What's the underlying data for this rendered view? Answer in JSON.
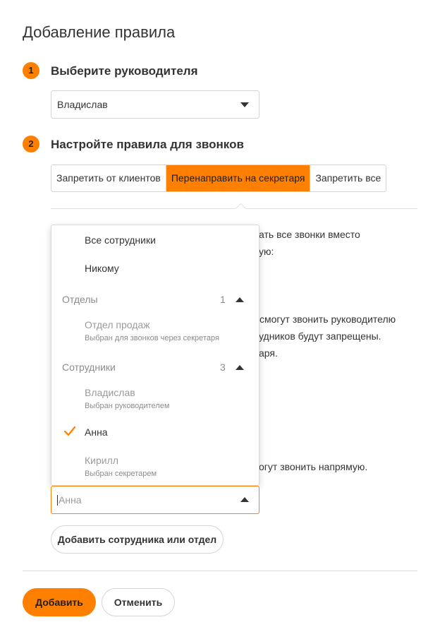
{
  "page": {
    "title": "Добавление правила"
  },
  "steps": [
    {
      "number": "1",
      "title": "Выберите руководителя"
    },
    {
      "number": "2",
      "title": "Настройте правила для звонков"
    }
  ],
  "manager_select": {
    "value": "Владислав"
  },
  "rule_tabs": [
    {
      "label": "Запретить от клиентов",
      "active": false
    },
    {
      "label": "Перенаправить на секретаря",
      "active": true
    },
    {
      "label": "Запретить все",
      "active": false
    }
  ],
  "background_text": {
    "line1": "ать все звонки вместо",
    "line2": "ую:",
    "line3": "смогут звонить руководителю",
    "line4": "удников будут запрещены.",
    "line5": "аря.",
    "line6": "огут звонить напрямую."
  },
  "dropdown": {
    "all_staff": "Все сотрудники",
    "nobody": "Никому",
    "departments_group": {
      "label": "Отделы",
      "count": "1"
    },
    "sales_dept": {
      "label": "Отдел продаж",
      "note": "Выбран для звонков через секретаря"
    },
    "employees_group": {
      "label": "Сотрудники",
      "count": "3"
    },
    "vladislav": {
      "label": "Владислав",
      "note": "Выбран руководителем"
    },
    "anna": {
      "label": "Анна",
      "selected": true
    },
    "kirill": {
      "label": "Кирилл",
      "note": "Выбран секретарем"
    }
  },
  "secretary_input": {
    "value": "Анна"
  },
  "buttons": {
    "add_member": "Добавить сотрудника или отдел",
    "submit": "Добавить",
    "cancel": "Отменить"
  },
  "colors": {
    "accent": "#ff8000",
    "border": "#d4d4d4",
    "muted": "#9a9a9a"
  }
}
